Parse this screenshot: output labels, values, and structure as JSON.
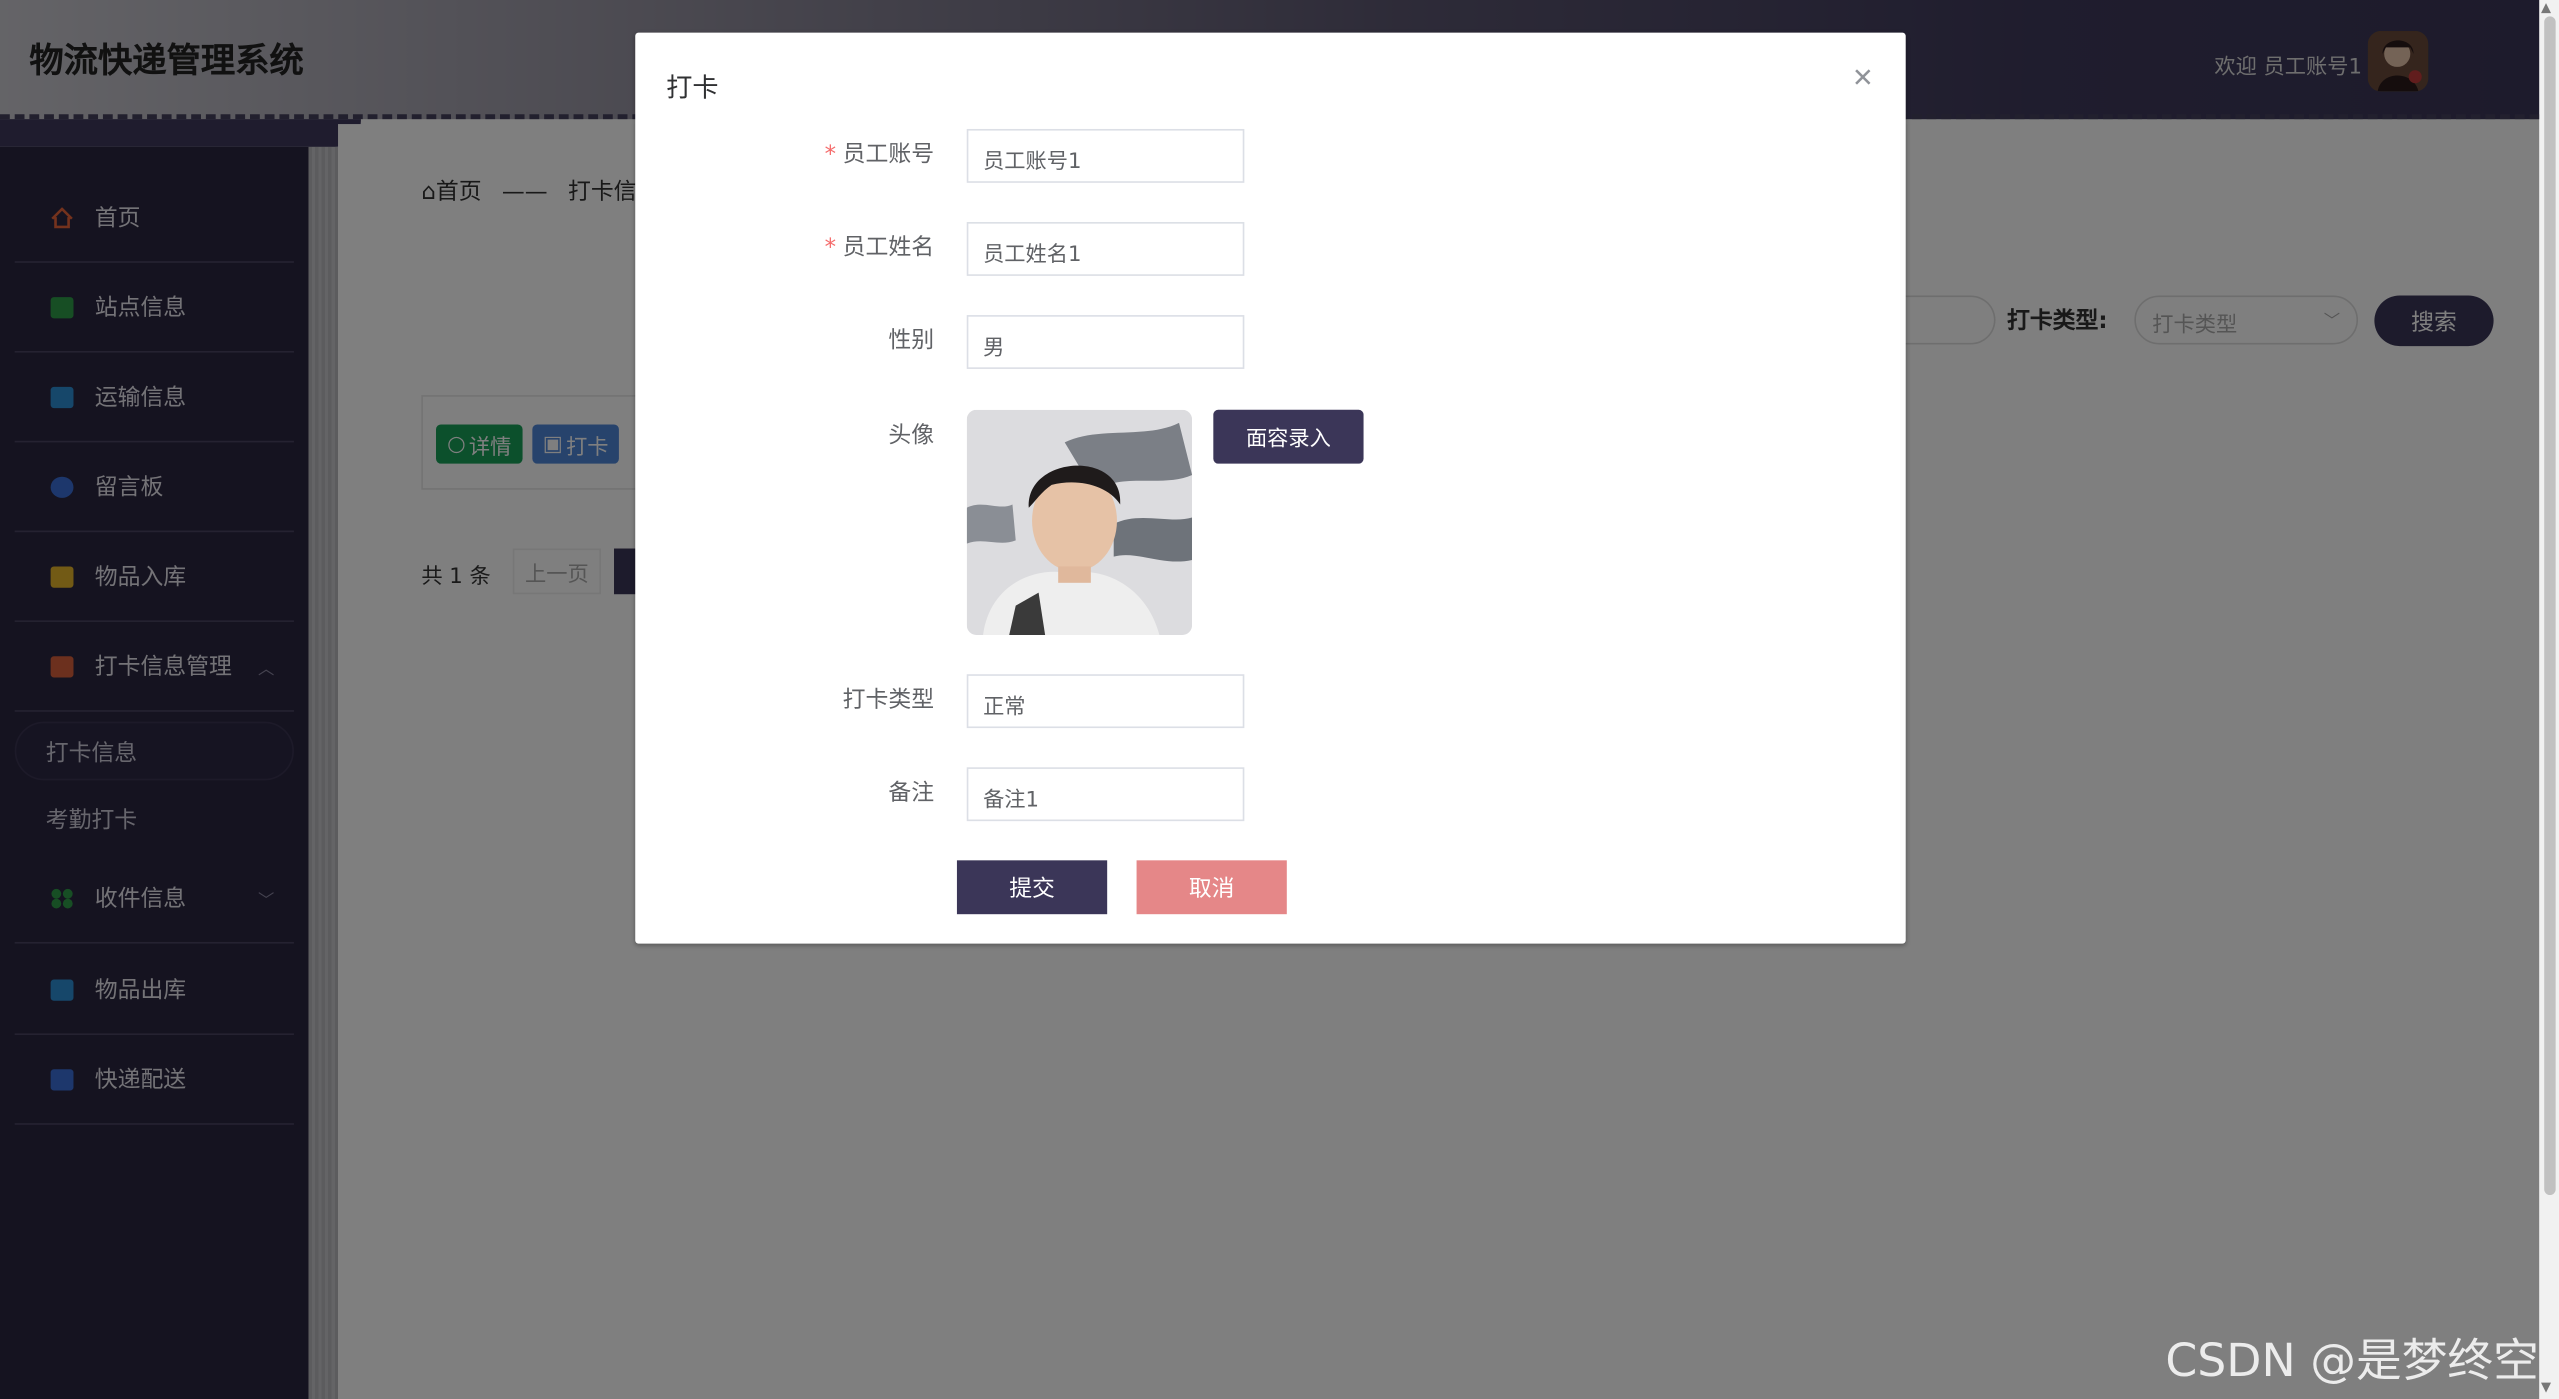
{
  "header": {
    "app_title": "物流快递管理系统",
    "welcome_text": "欢迎 员工账号1"
  },
  "sidebar": {
    "items": [
      {
        "label": "首页",
        "icon": "home-icon",
        "color": "#e8643a"
      },
      {
        "label": "站点信息",
        "icon": "book-icon",
        "color": "#2e9d48"
      },
      {
        "label": "运输信息",
        "icon": "bookmark-icon",
        "color": "#2c8fd4"
      },
      {
        "label": "留言板",
        "icon": "check-circle-icon",
        "color": "#3a6fd8"
      },
      {
        "label": "物品入库",
        "icon": "mail-icon",
        "color": "#e5b42a"
      },
      {
        "label": "打卡信息管理",
        "icon": "clipboard-icon",
        "color": "#d9603c"
      },
      {
        "label": "收件信息",
        "icon": "grid-icon",
        "color": "#2e9d48"
      },
      {
        "label": "物品出库",
        "icon": "archive-icon",
        "color": "#2c8fd4"
      },
      {
        "label": "快递配送",
        "icon": "calendar-icon",
        "color": "#3a6fd8"
      }
    ],
    "submenu": [
      "打卡信息",
      "考勤打卡"
    ]
  },
  "content": {
    "breadcrumb_home": "首页",
    "breadcrumb_sep": "——",
    "breadcrumb_current": "打卡信",
    "filter_label": "打卡类型:",
    "filter_placeholder": "打卡类型",
    "search_label": "搜索",
    "detail_label": "详情",
    "clock_label": "打卡",
    "pager_total": "共 1 条",
    "pager_prev": "上一页"
  },
  "dialog": {
    "title": "打卡",
    "fields": {
      "account_label": "员工账号",
      "account_value": "员工账号1",
      "name_label": "员工姓名",
      "name_value": "员工姓名1",
      "gender_label": "性别",
      "gender_value": "男",
      "avatar_label": "头像",
      "face_button": "面容录入",
      "type_label": "打卡类型",
      "type_value": "正常",
      "remark_label": "备注",
      "remark_value": "备注1"
    },
    "submit_label": "提交",
    "cancel_label": "取消"
  },
  "watermark": "CSDN @是梦终空",
  "colors": {
    "primary": "#3b3658",
    "cancel": "#e58788",
    "detail": "#18a058",
    "clock": "#4f86d8",
    "required": "#f56c6c"
  }
}
